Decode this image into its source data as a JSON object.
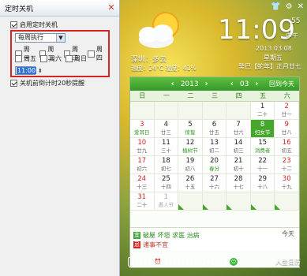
{
  "dialog": {
    "title": "定时关机",
    "enable_label": "启用定时关机",
    "repeat_select": "每周执行",
    "days": [
      "周一",
      "周二",
      "周三",
      "周四",
      "周五",
      "周六",
      "周日"
    ],
    "time_value": "11:00",
    "notify_label": "关机前倒计时20秒提醒"
  },
  "clock": {
    "time": "11:09",
    "seconds": ":55",
    "ampm": "中午",
    "date": "2013.03.08",
    "weekday": "星期五",
    "lunar": "癸巳【蛇年】正月廿七",
    "city_weather": "深圳：多云",
    "temps": "温度：24°C  湿度：41%"
  },
  "calendar": {
    "year": "2013",
    "month": "03",
    "today_button": "回到今天",
    "weekdays": [
      "日",
      "一",
      "二",
      "三",
      "四",
      "五",
      "六"
    ],
    "rows": [
      [
        {
          "n": "",
          "l": ""
        },
        {
          "n": "",
          "l": ""
        },
        {
          "n": "",
          "l": ""
        },
        {
          "n": "",
          "l": ""
        },
        {
          "n": "",
          "l": ""
        },
        {
          "n": "1",
          "l": "二十"
        },
        {
          "n": "2",
          "l": "廿一"
        }
      ],
      [
        {
          "n": "3",
          "l": "爱耳日"
        },
        {
          "n": "4",
          "l": "廿三"
        },
        {
          "n": "5",
          "l": "惊蛰"
        },
        {
          "n": "6",
          "l": "廿五"
        },
        {
          "n": "7",
          "l": "廿六"
        },
        {
          "n": "8",
          "l": "妇女节"
        },
        {
          "n": "9",
          "l": "廿八"
        }
      ],
      [
        {
          "n": "10",
          "l": "廿九"
        },
        {
          "n": "11",
          "l": "三十"
        },
        {
          "n": "12",
          "l": "植树节"
        },
        {
          "n": "13",
          "l": "初二"
        },
        {
          "n": "14",
          "l": "初三"
        },
        {
          "n": "15",
          "l": "消费者"
        },
        {
          "n": "16",
          "l": "初五"
        }
      ],
      [
        {
          "n": "17",
          "l": "初六"
        },
        {
          "n": "18",
          "l": "初七"
        },
        {
          "n": "19",
          "l": "初八"
        },
        {
          "n": "20",
          "l": "春分"
        },
        {
          "n": "21",
          "l": "初十"
        },
        {
          "n": "22",
          "l": "十一"
        },
        {
          "n": "23",
          "l": "十二"
        }
      ],
      [
        {
          "n": "24",
          "l": "十三"
        },
        {
          "n": "25",
          "l": "十四"
        },
        {
          "n": "26",
          "l": "十五"
        },
        {
          "n": "27",
          "l": "十六"
        },
        {
          "n": "28",
          "l": "十七"
        },
        {
          "n": "29",
          "l": "十八"
        },
        {
          "n": "30",
          "l": "十九"
        }
      ],
      [
        {
          "n": "31",
          "l": "二十"
        },
        {
          "n": "1",
          "l": "愚人节"
        },
        {
          "n": "",
          "l": ""
        },
        {
          "n": "",
          "l": ""
        },
        {
          "n": "",
          "l": ""
        },
        {
          "n": "",
          "l": ""
        },
        {
          "n": "",
          "l": ""
        }
      ]
    ],
    "almanac_yi": "破屋 坏垣 求医 治病",
    "almanac_ji": "诸事不宜",
    "yi_badge": "宜",
    "ji_badge": "忌",
    "today_label": "今天"
  },
  "footer": {
    "life_label": "人生日历"
  }
}
